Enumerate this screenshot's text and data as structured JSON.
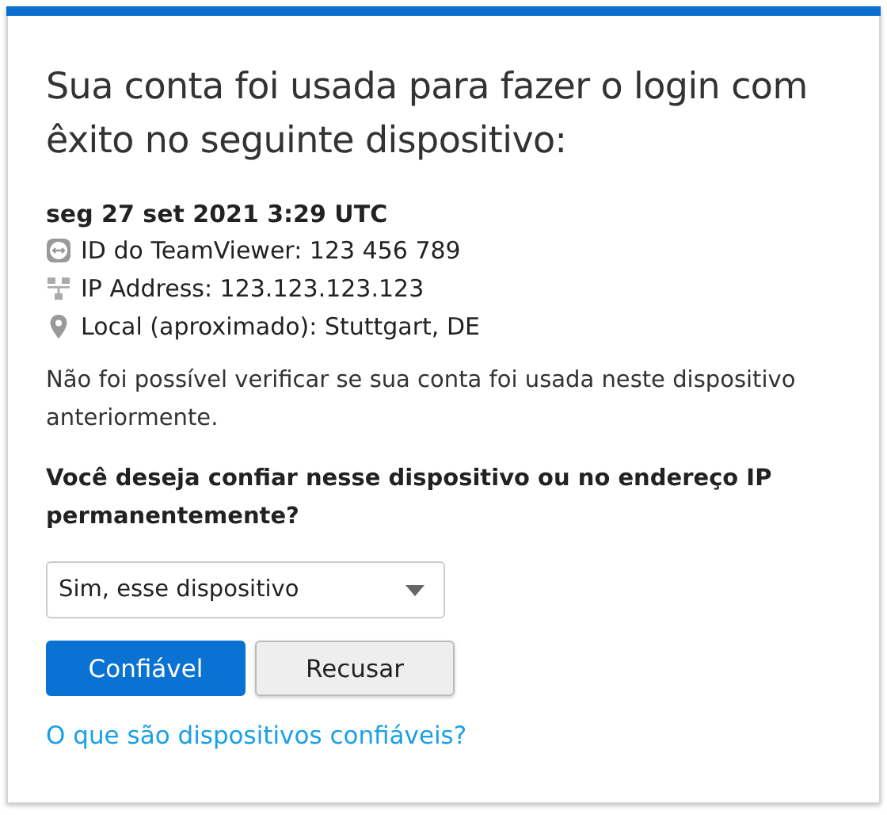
{
  "heading": "Sua conta foi usada para fazer o login com êxito no seguinte dispositivo:",
  "date": "seg 27 set 2021 3:29 UTC",
  "details": [
    {
      "kind": "teamviewer",
      "text": "ID do TeamViewer: 123 456 789"
    },
    {
      "kind": "network",
      "text": "IP Address: 123.123.123.123"
    },
    {
      "kind": "location",
      "text": "Local (aproximado): Stuttgart, DE"
    }
  ],
  "notice": "Não foi possível verificar se sua conta foi usada neste dispositivo anteriormente.",
  "question": "Você deseja confiar nesse dispositivo ou no endereço IP permanentemente?",
  "dropdown": {
    "value": "Sim, esse dispositivo"
  },
  "buttons": [
    {
      "kind": "primary",
      "label": "Confiável"
    },
    {
      "kind": "secondary",
      "label": "Recusar"
    }
  ],
  "link": "O que são dispositivos confiáveis?"
}
